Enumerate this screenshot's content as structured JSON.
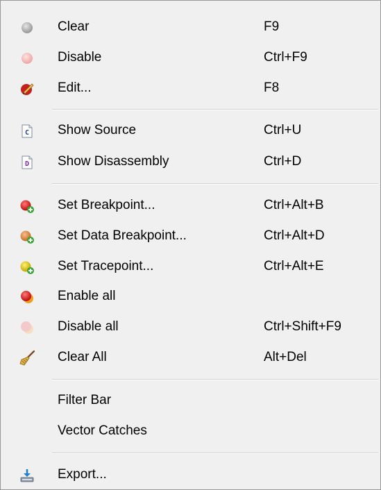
{
  "menu": {
    "items": [
      {
        "label": "Clear",
        "shortcut": "F9",
        "icon": "gray-dot-icon"
      },
      {
        "label": "Disable",
        "shortcut": "Ctrl+F9",
        "icon": "pink-dot-icon"
      },
      {
        "label": "Edit...",
        "shortcut": "F8",
        "icon": "edit-pencil-icon"
      },
      {
        "label": "Show Source",
        "shortcut": "Ctrl+U",
        "icon": "source-file-icon"
      },
      {
        "label": "Show Disassembly",
        "shortcut": "Ctrl+D",
        "icon": "disassembly-file-icon"
      },
      {
        "label": "Set Breakpoint...",
        "shortcut": "Ctrl+Alt+B",
        "icon": "add-breakpoint-icon"
      },
      {
        "label": "Set Data Breakpoint...",
        "shortcut": "Ctrl+Alt+D",
        "icon": "add-data-breakpoint-icon"
      },
      {
        "label": "Set Tracepoint...",
        "shortcut": "Ctrl+Alt+E",
        "icon": "add-tracepoint-icon"
      },
      {
        "label": "Enable all",
        "shortcut": "",
        "icon": "enable-all-icon"
      },
      {
        "label": "Disable all",
        "shortcut": "Ctrl+Shift+F9",
        "icon": "disable-all-icon"
      },
      {
        "label": "Clear All",
        "shortcut": "Alt+Del",
        "icon": "broom-icon"
      },
      {
        "label": "Filter Bar",
        "shortcut": ""
      },
      {
        "label": "Vector Catches",
        "shortcut": ""
      },
      {
        "label": "Export...",
        "shortcut": "",
        "icon": "export-icon"
      }
    ],
    "file_icon_letters": {
      "source": "C",
      "disassembly": "D"
    }
  }
}
